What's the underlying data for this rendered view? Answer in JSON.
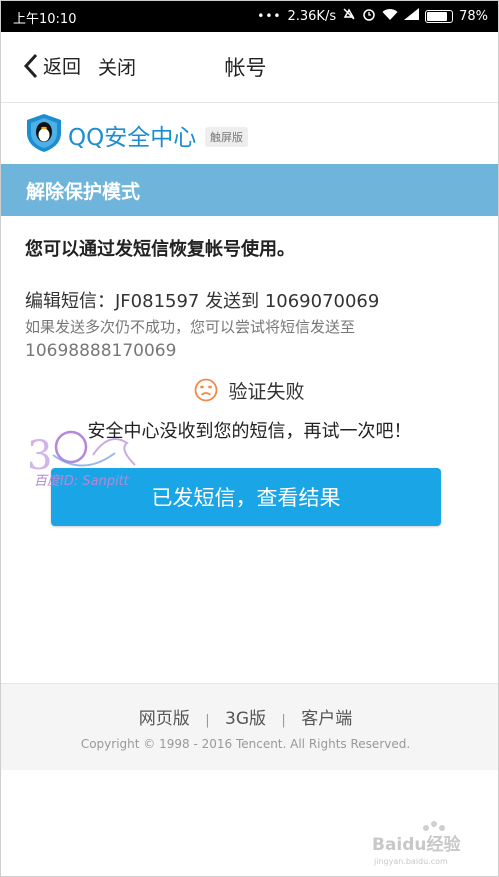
{
  "status_bar": {
    "time": "上午10:10",
    "network_speed": "2.36K/s",
    "battery": "78%",
    "icons": [
      "signal-dots-icon",
      "mute-icon",
      "alarm-icon",
      "wifi-icon",
      "cell-signal-icon",
      "battery-icon"
    ]
  },
  "header": {
    "back_label": "返回",
    "close_label": "关闭",
    "title": "帐号"
  },
  "brand": {
    "name": "QQ安全中心",
    "badge": "触屏版",
    "logo_color": "#1a8ed1"
  },
  "banner": {
    "title": "解除保护模式",
    "color": "#6fb4db"
  },
  "content": {
    "lead": "您可以通过发短信恢复帐号使用。",
    "sms_instruction": "编辑短信：JF081597 发送到 1069070069",
    "retry_hint": "如果发送多次仍不成功，您可以尝试将短信发送至",
    "alt_number": "10698888170069",
    "status_label": "验证失败",
    "notice": "安全中心没收到您的短信，再试一次吧！",
    "cta_label": "已发短信，查看结果",
    "cta_color": "#1aa6e6"
  },
  "watermark": {
    "text": "百度ID: Sanpitt"
  },
  "footer": {
    "links": [
      "网页版",
      "3G版",
      "客户端"
    ],
    "separator": "|",
    "copyright": "Copyright © 1998 - 2016 Tencent. All Rights Reserved."
  },
  "baidu_watermark": {
    "text": "Baidu经验",
    "sub": "jingyan.baidu.com"
  }
}
